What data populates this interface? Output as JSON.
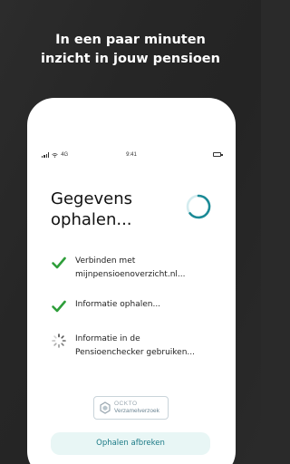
{
  "headline": {
    "line1": "In een paar minuten",
    "line2": "inzicht in jouw pensioen"
  },
  "status_bar": {
    "network": "4G",
    "time": "9:41"
  },
  "title": {
    "line1": "Gegevens",
    "line2": "ophalen..."
  },
  "steps": [
    {
      "state": "done",
      "icon": "checkmark-icon",
      "line1": "Verbinden met",
      "line2": "mijnpensioenoverzicht.nl..."
    },
    {
      "state": "done",
      "icon": "checkmark-icon",
      "line1": "Informatie ophalen...",
      "line2": ""
    },
    {
      "state": "loading",
      "icon": "spinner-icon",
      "line1": "Informatie in de",
      "line2": "Pensioenchecker gebruiken..."
    }
  ],
  "logo": {
    "brand": "OCKTO",
    "label": "Verzamelverzoek"
  },
  "cancel_button": {
    "label": "Ophalen afbreken"
  },
  "colors": {
    "accent": "#1b8a96",
    "check": "#2e9e3a",
    "button_bg": "#e8f6f5",
    "background": "#2a2a2a"
  }
}
